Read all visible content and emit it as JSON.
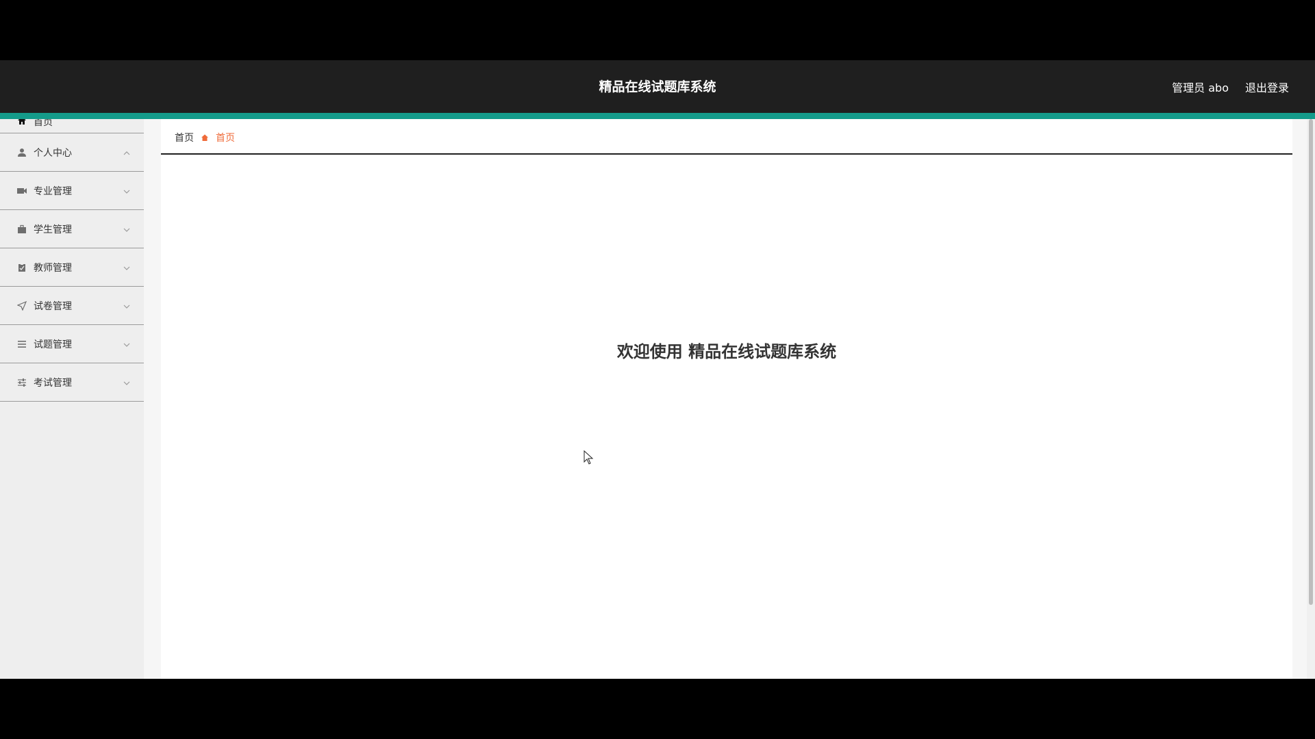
{
  "header": {
    "title": "精品在线试题库系统",
    "user": "管理员 abo",
    "logout": "退出登录"
  },
  "sidebar": {
    "items": [
      {
        "label": "首页",
        "icon": "home-icon"
      },
      {
        "label": "个人中心",
        "icon": "user-icon",
        "state": "expanded"
      },
      {
        "label": "专业管理",
        "icon": "video-icon"
      },
      {
        "label": "学生管理",
        "icon": "briefcase-icon"
      },
      {
        "label": "教师管理",
        "icon": "clipboard-icon"
      },
      {
        "label": "试卷管理",
        "icon": "send-icon"
      },
      {
        "label": "试题管理",
        "icon": "list-icon"
      },
      {
        "label": "考试管理",
        "icon": "sliders-icon"
      }
    ]
  },
  "breadcrumb": {
    "root": "首页",
    "current": "首页"
  },
  "main": {
    "welcome": "欢迎使用 精品在线试题库系统"
  },
  "colors": {
    "header_bg": "#1f1f1f",
    "accent": "#149b8a",
    "breadcrumb_active": "#ef6b3a",
    "sidebar_bg": "#eeeeee"
  }
}
